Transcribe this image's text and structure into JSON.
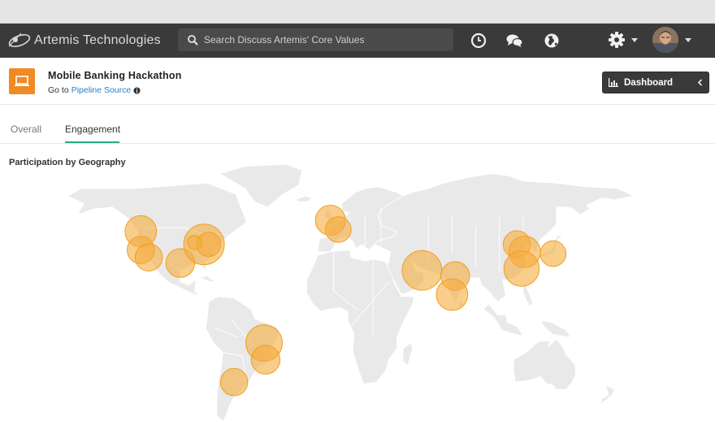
{
  "app": {
    "brand_name": "Artemis Technologies",
    "search_placeholder": "Search Discuss Artemis' Core Values"
  },
  "icons": {
    "logo": "orbit-logo-icon",
    "search": "search-icon",
    "history": "clock-icon",
    "discussions": "chat-bubbles-icon",
    "explore": "globe-icon",
    "settings": "gear-icon",
    "user": "avatar"
  },
  "project": {
    "title": "Mobile Banking Hackathon",
    "goto_prefix": "Go to",
    "goto_link": "Pipeline Source",
    "icon_color": "#f08a24"
  },
  "dashboard_button": {
    "label": "Dashboard"
  },
  "tabs": [
    {
      "label": "Overall",
      "active": false
    },
    {
      "label": "Engagement",
      "active": true
    }
  ],
  "section": {
    "title": "Participation by Geography"
  },
  "map": {
    "land_color": "#e9e9e9",
    "border_color": "#ffffff",
    "bubble_fill": "#f5ac3c",
    "bubble_stroke": "#f0a020",
    "bubbles": [
      {
        "region": "US West",
        "lat": 47,
        "lon": -122,
        "size": 0.6
      },
      {
        "region": "US California",
        "lat": 37,
        "lon": -122,
        "size": 0.45
      },
      {
        "region": "US Southwest",
        "lat": 33,
        "lon": -117,
        "size": 0.45
      },
      {
        "region": "US South",
        "lat": 30,
        "lon": -97,
        "size": 0.5
      },
      {
        "region": "US East",
        "lat": 40,
        "lon": -82,
        "size": 1.0
      },
      {
        "region": "US Northeast",
        "lat": 40,
        "lon": -79,
        "size": 0.35
      },
      {
        "region": "UK",
        "lat": 53,
        "lon": -2,
        "size": 0.55
      },
      {
        "region": "France",
        "lat": 48,
        "lon": 3,
        "size": 0.4
      },
      {
        "region": "Middle East",
        "lat": 26,
        "lon": 56,
        "size": 0.95
      },
      {
        "region": "India North",
        "lat": 23,
        "lon": 77,
        "size": 0.5
      },
      {
        "region": "India South",
        "lat": 13,
        "lon": 75,
        "size": 0.6
      },
      {
        "region": "China North",
        "lat": 40,
        "lon": 116,
        "size": 0.45
      },
      {
        "region": "China East",
        "lat": 36,
        "lon": 121,
        "size": 0.6
      },
      {
        "region": "China South",
        "lat": 27,
        "lon": 119,
        "size": 0.75
      },
      {
        "region": "Japan",
        "lat": 35,
        "lon": 139,
        "size": 0.4
      },
      {
        "region": "Brazil",
        "lat": -13,
        "lon": -44,
        "size": 0.8
      },
      {
        "region": "Brazil South",
        "lat": -22,
        "lon": -43,
        "size": 0.5
      },
      {
        "region": "Argentina",
        "lat": -34,
        "lon": -63,
        "size": 0.45
      },
      {
        "region": "US Midwest",
        "lat": 41,
        "lon": -88,
        "size": 0.12
      }
    ]
  }
}
